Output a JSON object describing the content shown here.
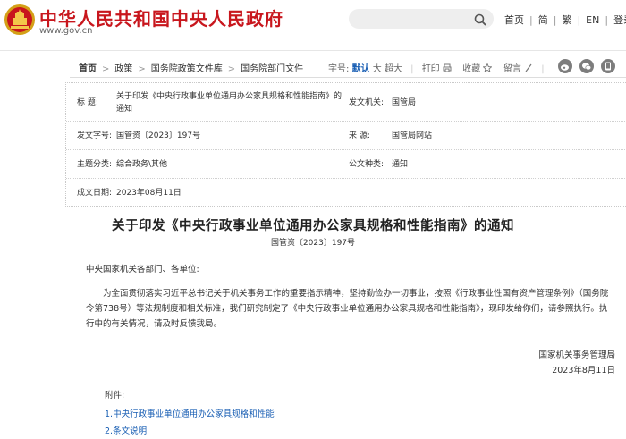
{
  "header": {
    "site_title": "中华人民共和国中央人民政府",
    "site_domain": "www.gov.cn",
    "search_placeholder": "",
    "nav": [
      "首页",
      "简",
      "繁",
      "EN",
      "登录"
    ]
  },
  "breadcrumb": [
    "首页",
    "政策",
    "国务院政策文件库",
    "国务院部门文件"
  ],
  "tools": {
    "font_size_label": "字号:",
    "font_sizes": [
      "默认",
      "大",
      "超大"
    ],
    "font_size_selected": "默认",
    "print": "打印",
    "favorite": "收藏",
    "comment": "留言"
  },
  "meta": {
    "title_label": "标    题:",
    "title_value": "关于印发《中央行政事业单位通用办公家具规格和性能指南》的通知",
    "issuer_label": "发文机关:",
    "issuer_value": "国管局",
    "doc_no_label": "发文字号:",
    "doc_no_value": "国管资〔2023〕197号",
    "source_label": "来    源:",
    "source_value": "国管局网站",
    "category_label": "主题分类:",
    "category_value": "综合政务\\其他",
    "type_label": "公文种类:",
    "type_value": "通知",
    "date_label": "成文日期:",
    "date_value": "2023年08月11日"
  },
  "article": {
    "title": "关于印发《中央行政事业单位通用办公家具规格和性能指南》的通知",
    "doc_number": "国管资〔2023〕197号",
    "salutation": "中央国家机关各部门、各单位:",
    "body": "为全面贯彻落实习近平总书记关于机关事务工作的重要指示精神，坚持勤俭办一切事业，按照《行政事业性国有资产管理条例》（国务院令第738号）等法规制度和相关标准，我们研究制定了《中央行政事业单位通用办公家具规格和性能指南》，现印发给你们，请参照执行。执行中的有关情况，请及时反馈我局。",
    "signature_org": "国家机关事务管理局",
    "signature_date": "2023年8月11日",
    "attachments_label": "附件:",
    "attachments": [
      {
        "num": "1.",
        "text": "中央行政事业单位通用办公家具规格和性能"
      },
      {
        "num": "2.",
        "text": "条文说明"
      }
    ]
  },
  "colors": {
    "brand_red": "#c8161d",
    "link_blue": "#1a5fb4",
    "search_bg": "#eeeeee"
  },
  "icons": [
    "national-emblem",
    "search-icon",
    "print-icon",
    "star-icon",
    "comment-icon",
    "weibo-icon",
    "wechat-icon",
    "app-icon"
  ]
}
